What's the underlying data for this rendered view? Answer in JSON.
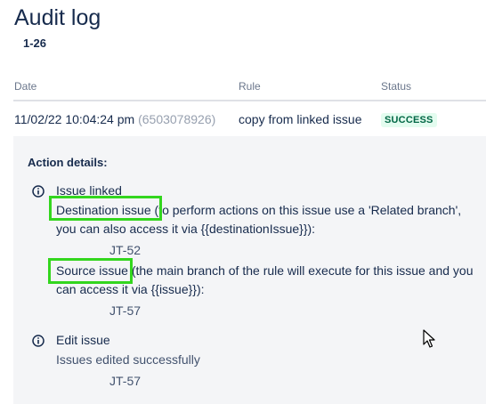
{
  "page": {
    "title": "Audit log",
    "range": "1-26"
  },
  "table": {
    "headers": {
      "date": "Date",
      "rule": "Rule",
      "status": "Status"
    },
    "row": {
      "date": "11/02/22 10:04:24 pm",
      "id": "(6503078926)",
      "rule": "copy from linked issue",
      "status": "SUCCESS"
    }
  },
  "details": {
    "title": "Action details:",
    "entries": [
      {
        "heading": "Issue linked",
        "dest_label": "Destination issue",
        "dest_text_1": " (to perform actions on this issue use a 'Related branch',",
        "dest_text_2": "you can also access it via {{destinationIssue}}):",
        "dest_value": "JT-52",
        "src_label": "Source issue",
        "src_text_1": " (the main branch of the rule will execute for this issue and you",
        "src_text_2": "can access it via {{issue}}):",
        "src_value": "JT-57"
      },
      {
        "heading": "Edit issue",
        "text": "Issues edited successfully",
        "value": "JT-57"
      }
    ]
  },
  "colors": {
    "highlight": "#33d61e",
    "success_bg": "#e3fcef",
    "success_text": "#006644",
    "panel_bg": "#f4f5f7"
  }
}
